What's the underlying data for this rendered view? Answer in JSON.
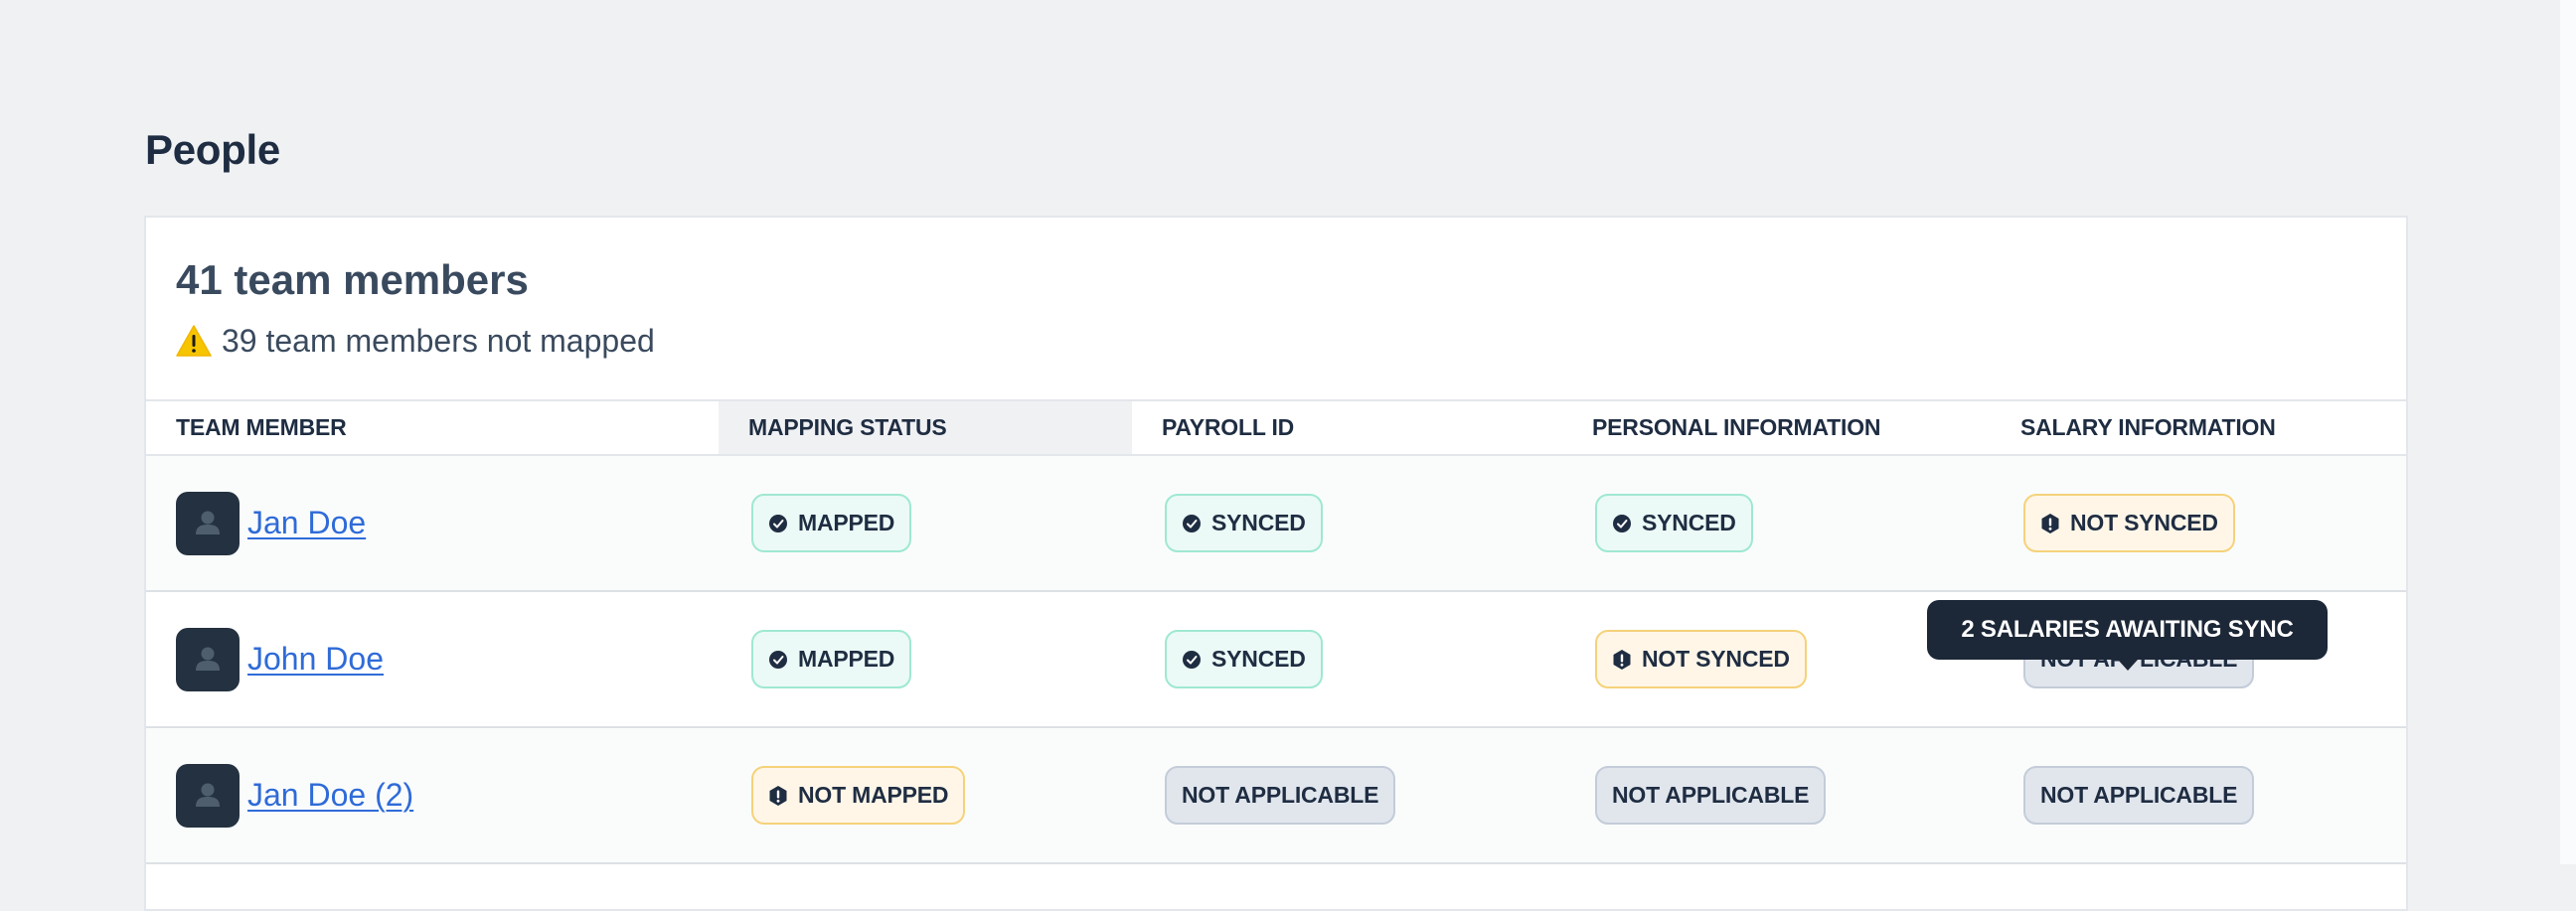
{
  "page": {
    "title": "People"
  },
  "summary": {
    "count_title": "41 team members",
    "warning_text": "39 team members not mapped",
    "warning_icon": "warning-triangle-icon"
  },
  "table": {
    "columns": [
      {
        "label": "TEAM MEMBER"
      },
      {
        "label": "MAPPING STATUS",
        "sorted": true
      },
      {
        "label": "PAYROLL ID"
      },
      {
        "label": "PERSONAL INFORMATION"
      },
      {
        "label": "SALARY INFORMATION"
      }
    ],
    "rows": [
      {
        "name": "Jan Doe",
        "avatar_icon": "user-icon",
        "mapping_status": {
          "label": "MAPPED",
          "type": "success",
          "icon": "check-circle-icon"
        },
        "payroll_id": {
          "label": "SYNCED",
          "type": "success",
          "icon": "check-circle-icon"
        },
        "personal_information": {
          "label": "SYNCED",
          "type": "success",
          "icon": "check-circle-icon"
        },
        "salary_information": {
          "label": "NOT SYNCED",
          "type": "warning",
          "icon": "alert-hexagon-icon"
        }
      },
      {
        "name": "John Doe",
        "avatar_icon": "user-icon",
        "mapping_status": {
          "label": "MAPPED",
          "type": "success",
          "icon": "check-circle-icon"
        },
        "payroll_id": {
          "label": "SYNCED",
          "type": "success",
          "icon": "check-circle-icon"
        },
        "personal_information": {
          "label": "NOT SYNCED",
          "type": "warning",
          "icon": "alert-hexagon-icon"
        },
        "salary_information": {
          "label": "NOT APPLICABLE",
          "type": "neutral",
          "icon": null
        }
      },
      {
        "name": "Jan Doe (2)",
        "avatar_icon": "user-icon",
        "mapping_status": {
          "label": "NOT MAPPED",
          "type": "warning",
          "icon": "alert-hexagon-icon"
        },
        "payroll_id": {
          "label": "NOT APPLICABLE",
          "type": "neutral",
          "icon": null
        },
        "personal_information": {
          "label": "NOT APPLICABLE",
          "type": "neutral",
          "icon": null
        },
        "salary_information": {
          "label": "NOT APPLICABLE",
          "type": "neutral",
          "icon": null
        }
      }
    ]
  },
  "tooltip": {
    "text": "2 SALARIES AWAITING SYNC",
    "anchor": "row-1-salary-information"
  },
  "colors": {
    "link": "#2F6BD8",
    "success_bg": "#EBFAF6",
    "success_border": "#9FE8D1",
    "warning_bg": "#FFF6E8",
    "warning_border": "#F5D27A",
    "neutral_bg": "#E1E6ED",
    "neutral_border": "#C3CCD8",
    "tooltip_bg": "#1C2737",
    "warning_icon": "#F7C400"
  }
}
